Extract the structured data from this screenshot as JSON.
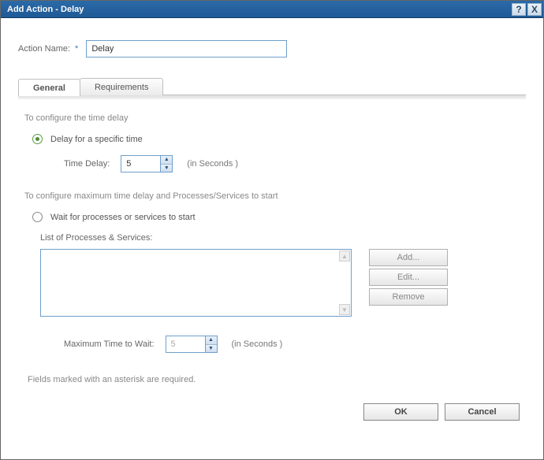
{
  "titlebar": {
    "title": "Add Action - Delay",
    "help_symbol": "?",
    "close_symbol": "X"
  },
  "form": {
    "action_name_label": "Action Name:",
    "required_marker": "*",
    "action_name_value": "Delay"
  },
  "tabs": {
    "general": "General",
    "requirements": "Requirements"
  },
  "pane": {
    "specific_heading": "To configure the time delay",
    "opt_specific": "Delay for a specific time",
    "time_delay_label": "Time Delay:",
    "time_delay_value": "5",
    "seconds_suffix": "(in Seconds )",
    "max_heading": "To configure maximum time delay and Processes/Services to start",
    "opt_wait": "Wait for processes or services to start",
    "list_label": "List of Processes & Services:",
    "btn_add": "Add...",
    "btn_edit": "Edit...",
    "btn_remove": "Remove",
    "max_wait_label": "Maximum Time to Wait:",
    "max_wait_value": "5",
    "required_note": "Fields marked with an asterisk are required."
  },
  "buttons": {
    "ok": "OK",
    "cancel": "Cancel"
  }
}
